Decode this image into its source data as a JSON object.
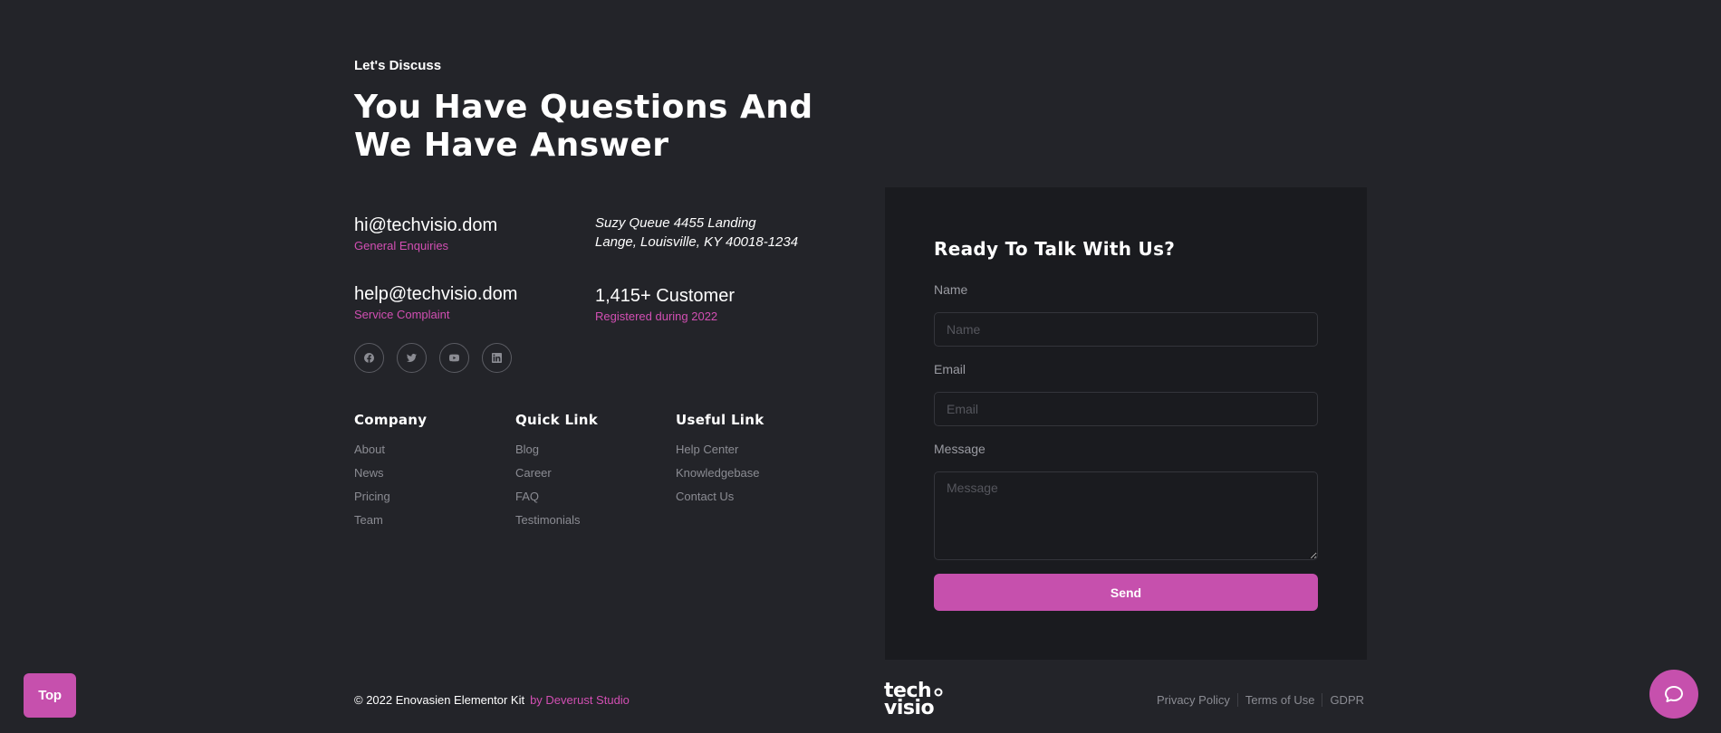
{
  "header": {
    "kicker": "Let's Discuss",
    "headline": "You Have Questions And We Have Answer"
  },
  "contacts": {
    "general_email": "hi@techvisio.dom",
    "general_label": "General Enquiries",
    "support_email": "help@techvisio.dom",
    "support_label": "Service Complaint",
    "address_line1": "Suzy Queue 4455 Landing",
    "address_line2": "Lange, Louisville, KY 40018-1234",
    "customers_count": "1,415+ Customer",
    "customers_label": "Registered during 2022"
  },
  "socials": [
    {
      "icon": "facebook-icon"
    },
    {
      "icon": "twitter-icon"
    },
    {
      "icon": "youtube-icon"
    },
    {
      "icon": "linkedin-icon"
    }
  ],
  "footer_links": {
    "company": {
      "title": "Company",
      "items": [
        "About",
        "News",
        "Pricing",
        "Team"
      ]
    },
    "quick": {
      "title": "Quick Link",
      "items": [
        "Blog",
        "Career",
        "FAQ",
        "Testimonials"
      ]
    },
    "useful": {
      "title": "Useful Link",
      "items": [
        "Help Center",
        "Knowledgebase",
        "Contact Us"
      ]
    }
  },
  "form": {
    "title": "Ready To Talk With Us?",
    "name_label": "Name",
    "name_placeholder": "Name",
    "email_label": "Email",
    "email_placeholder": "Email",
    "message_label": "Message",
    "message_placeholder": "Message",
    "send_label": "Send"
  },
  "footer": {
    "copyright": "© 2022 Enovasien Elementor Kit",
    "studio": "by Deverust Studio",
    "logo_line1": "tech",
    "logo_line2": "visio",
    "legal": [
      "Privacy Policy",
      "Terms of Use",
      "GDPR"
    ]
  },
  "floating": {
    "top_label": "Top",
    "chat_icon": "chat-bubble-icon"
  },
  "colors": {
    "background": "#232429",
    "card": "#1a1b1f",
    "accent": "#c650ad",
    "accent_text": "#d24fb3"
  }
}
